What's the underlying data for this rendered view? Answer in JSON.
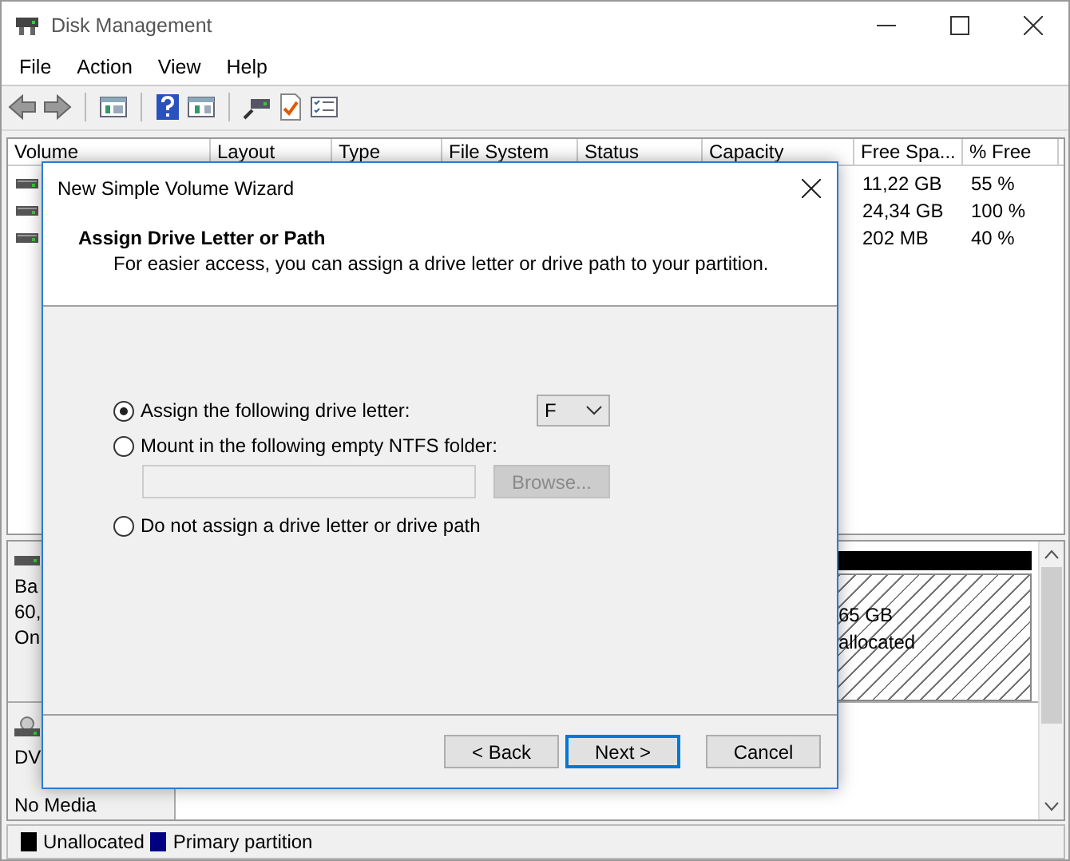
{
  "window": {
    "title": "Disk Management"
  },
  "menu": [
    "File",
    "Action",
    "View",
    "Help"
  ],
  "volume_list": {
    "columns": [
      "Volume",
      "Layout",
      "Type",
      "File System",
      "Status",
      "Capacity",
      "Free Spa...",
      "% Free"
    ],
    "rows": [
      {
        "free_space": "11,22 GB",
        "percent_free": "55 %"
      },
      {
        "free_space": "24,34 GB",
        "percent_free": "100 %"
      },
      {
        "free_space": "202 MB",
        "percent_free": "40 %"
      }
    ]
  },
  "disks": [
    {
      "kind": "hdd",
      "label_lines": [
        "Ba",
        "60,",
        "On"
      ],
      "partitions": [
        {
          "kind": "unallocated",
          "lines": [
            "65 GB",
            "allocated"
          ]
        }
      ]
    },
    {
      "kind": "dvd",
      "label_lines": [
        "DV",
        "No Media"
      ]
    }
  ],
  "legend": [
    {
      "label": "Unallocated",
      "color": "#000000"
    },
    {
      "label": "Primary partition",
      "color": "#000080"
    }
  ],
  "dialog": {
    "title": "New Simple Volume Wizard",
    "heading": "Assign Drive Letter or Path",
    "subtitle": "For easier access, you can assign a drive letter or drive path to your partition.",
    "options": [
      {
        "kind": "letter",
        "label": "Assign the following drive letter:",
        "selected": true
      },
      {
        "kind": "folder",
        "label": "Mount in the following empty NTFS folder:",
        "selected": false
      },
      {
        "kind": "none",
        "label": "Do not assign a drive letter or drive path",
        "selected": false
      }
    ],
    "drive_letter": "F",
    "folder_field": {
      "disabled": true
    },
    "browse_button": {
      "label": "Browse...",
      "disabled": true
    },
    "buttons": [
      {
        "label": "< Back",
        "default": false
      },
      {
        "label": "Next >",
        "default": true
      },
      {
        "label": "Cancel",
        "default": false
      }
    ]
  }
}
